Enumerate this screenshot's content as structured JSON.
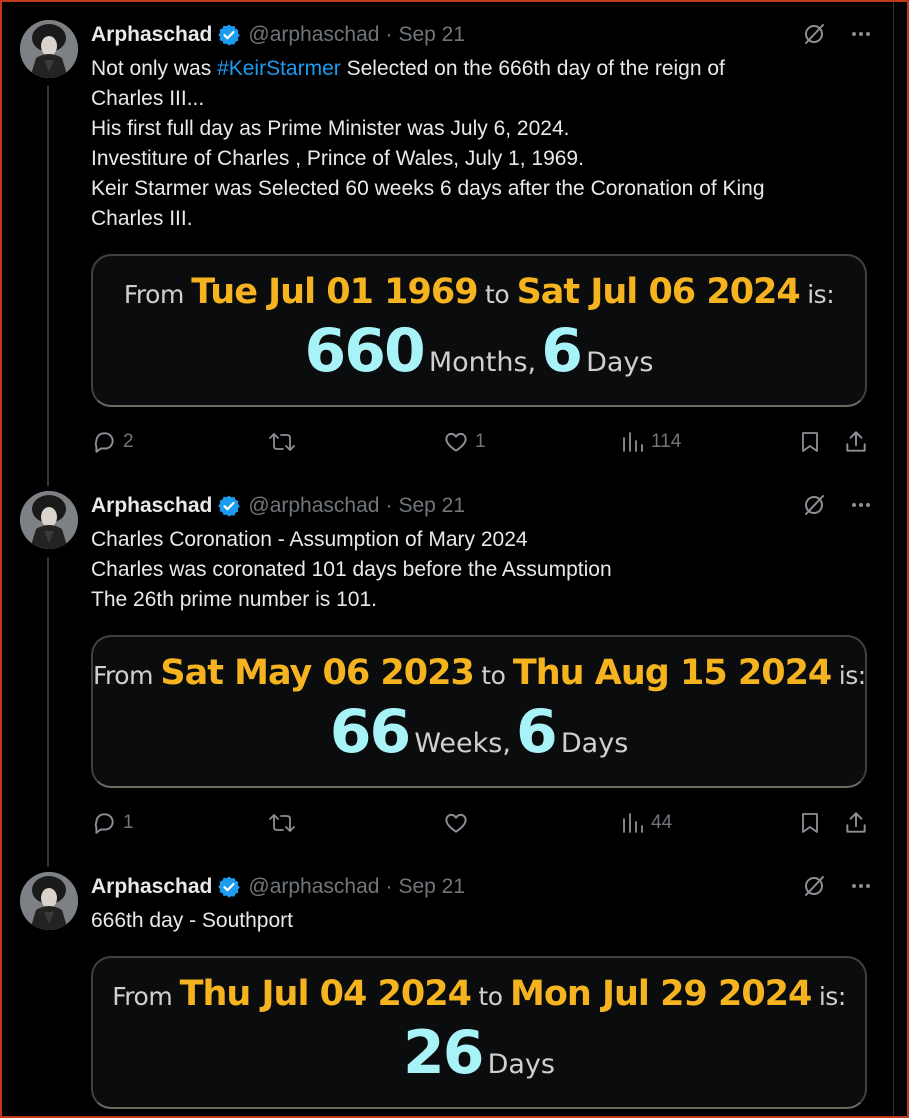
{
  "tweets": [
    {
      "author": {
        "name": "Arphaschad",
        "handle": "@arphaschad"
      },
      "date": "Sep 21",
      "text_lines": [
        {
          "before": "Not only was ",
          "hashtag": "#KeirStarmer",
          "after": " Selected on the 666th day of the reign of"
        },
        "Charles III...",
        "His first full day as Prime Minister was July 6, 2024.",
        "Investiture of Charles , Prince of Wales, July 1, 1969.",
        "Keir Starmer was Selected 60 weeks 6 days after the Coronation of King",
        "Charles III."
      ],
      "card": {
        "from_label": "From",
        "from_date": "Tue Jul 01 1969",
        "to_label": "to",
        "to_date": "Sat Jul 06 2024",
        "is_label": "is:",
        "num1": "660",
        "unit1": "Months,",
        "num2": "6",
        "unit2": "Days"
      },
      "actions": {
        "replies": "2",
        "reposts": "",
        "likes": "1",
        "views": "114"
      }
    },
    {
      "author": {
        "name": "Arphaschad",
        "handle": "@arphaschad"
      },
      "date": "Sep 21",
      "text_lines": [
        "Charles Coronation - Assumption of Mary 2024",
        "Charles was coronated 101 days before the Assumption",
        "The 26th prime number is 101."
      ],
      "card": {
        "from_label": "From",
        "from_date": "Sat May 06 2023",
        "to_label": "to",
        "to_date": "Thu Aug 15 2024",
        "is_label": "is:",
        "num1": "66",
        "unit1": "Weeks,",
        "num2": "6",
        "unit2": "Days"
      },
      "actions": {
        "replies": "1",
        "reposts": "",
        "likes": "",
        "views": "44"
      }
    },
    {
      "author": {
        "name": "Arphaschad",
        "handle": "@arphaschad"
      },
      "date": "Sep 21",
      "text_lines": [
        "666th day - Southport"
      ],
      "card": {
        "from_label": "From",
        "from_date": "Thu Jul 04 2024",
        "to_label": "to",
        "to_date": "Mon Jul 29 2024",
        "is_label": "is:",
        "num1": "26",
        "unit1": "Days",
        "num2": "",
        "unit2": ""
      },
      "actions": null
    }
  ],
  "icons": {
    "verified": "verified-badge-icon",
    "grok": "grok-icon",
    "more": "more-dots-icon",
    "reply": "reply-icon",
    "repost": "repost-icon",
    "like": "heart-icon",
    "views": "views-chart-icon",
    "bookmark": "bookmark-icon",
    "share": "share-icon"
  },
  "colors": {
    "background": "#000000",
    "hashtag": "#1d9bf0",
    "card_date": "#f5b41f",
    "card_number": "#a8f3f7",
    "muted": "#71767b",
    "frame_border": "#c1391b"
  }
}
